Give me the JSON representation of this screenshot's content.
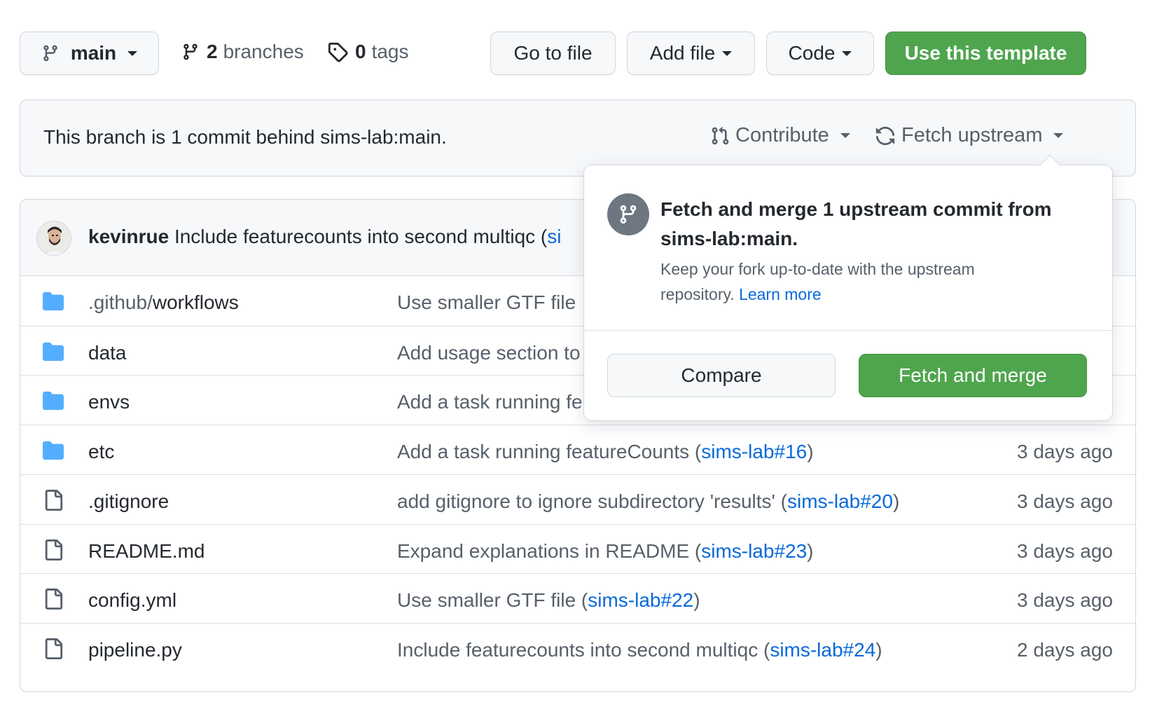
{
  "toolbar": {
    "branch_button": "main",
    "branches_count": "2",
    "branches_label": "branches",
    "tags_count": "0",
    "tags_label": "tags",
    "go_to_file": "Go to file",
    "add_file": "Add file",
    "code": "Code",
    "use_template": "Use this template"
  },
  "branch_info": {
    "text": "This branch is 1 commit behind sims-lab:main.",
    "contribute": "Contribute",
    "fetch_upstream": "Fetch upstream"
  },
  "latest_commit": {
    "author": "kevinrue",
    "message": "Include featurecounts into second multiqc (",
    "link_partial": "si"
  },
  "files": [
    {
      "type": "folder",
      "name_prefix": ".github/",
      "name": "workflows",
      "message": "Use smaller GTF file",
      "link": "",
      "suffix": "",
      "age": ""
    },
    {
      "type": "folder",
      "name_prefix": "",
      "name": "data",
      "message": "Add usage section to",
      "link": "",
      "suffix": "",
      "age": ""
    },
    {
      "type": "folder",
      "name_prefix": "",
      "name": "envs",
      "message": "Add a task running fe",
      "link": "",
      "suffix": "",
      "age": ""
    },
    {
      "type": "folder",
      "name_prefix": "",
      "name": "etc",
      "message": "Add a task running featureCounts (",
      "link": "sims-lab#16",
      "suffix": ")",
      "age": "3 days ago"
    },
    {
      "type": "file",
      "name_prefix": "",
      "name": ".gitignore",
      "message": "add gitignore to ignore subdirectory 'results' (",
      "link": "sims-lab#20",
      "suffix": ")",
      "age": "3 days ago"
    },
    {
      "type": "file",
      "name_prefix": "",
      "name": "README.md",
      "message": "Expand explanations in README (",
      "link": "sims-lab#23",
      "suffix": ")",
      "age": "3 days ago"
    },
    {
      "type": "file",
      "name_prefix": "",
      "name": "config.yml",
      "message": "Use smaller GTF file (",
      "link": "sims-lab#22",
      "suffix": ")",
      "age": "3 days ago"
    },
    {
      "type": "file",
      "name_prefix": "",
      "name": "pipeline.py",
      "message": "Include featurecounts into second multiqc (",
      "link": "sims-lab#24",
      "suffix": ")",
      "age": "2 days ago"
    }
  ],
  "popover": {
    "title": "Fetch and merge 1 upstream commit from sims-lab:main.",
    "description": "Keep your fork up-to-date with the upstream repository.",
    "learn_more": "Learn more",
    "compare": "Compare",
    "fetch_and_merge": "Fetch and merge"
  },
  "colors": {
    "green": "#4fa54e",
    "link": "#0969da",
    "folder": "#54aeff"
  }
}
